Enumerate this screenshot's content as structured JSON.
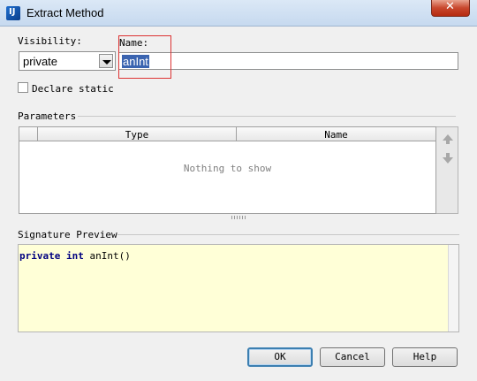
{
  "window": {
    "title": "Extract Method",
    "close_glyph": "✕"
  },
  "form": {
    "visibility_label": "Visibility:",
    "visibility_value": "private",
    "name_label": "Name:",
    "name_value": "anInt",
    "declare_static_label": "Declare static",
    "declare_static_checked": false
  },
  "parameters": {
    "section_label": "Parameters",
    "columns": [
      "",
      "Type",
      "Name"
    ],
    "empty_text": "Nothing to show",
    "move_up_icon": "arrow-up-icon",
    "move_down_icon": "arrow-down-icon"
  },
  "signature": {
    "section_label": "Signature Preview",
    "keyword1": "private",
    "keyword2": "int",
    "method": "anInt()"
  },
  "buttons": {
    "ok": "OK",
    "cancel": "Cancel",
    "help": "Help"
  },
  "colors": {
    "selection": "#3a64b0",
    "preview_bg": "#ffffd7",
    "keyword": "#000080",
    "highlight_box": "#dd3333"
  }
}
